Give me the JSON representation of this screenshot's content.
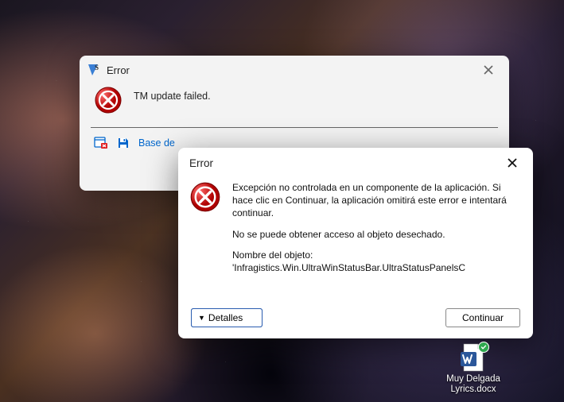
{
  "dialog1": {
    "title": "Error",
    "message": "TM update failed.",
    "footer_link": "Base de",
    "icons": {
      "app": "app-s-icon",
      "error": "error-icon",
      "file_error": "tm-file-error-icon",
      "save": "save-icon"
    }
  },
  "dialog2": {
    "title": "Error",
    "paragraph1": "Excepción no controlada en un componente de la aplicación. Si hace clic en Continuar, la aplicación omitirá este error e intentará continuar.",
    "paragraph2": "No se puede obtener acceso al objeto desechado.",
    "paragraph3_label": "Nombre del objeto:",
    "paragraph3_value": "'Infragistics.Win.UltraWinStatusBar.UltraStatusPanelsC",
    "details_button": "Detalles",
    "continue_button": "Continuar"
  },
  "desktop_icon": {
    "filename_line1": "Muy Delgada",
    "filename_line2": "Lyrics.docx"
  }
}
